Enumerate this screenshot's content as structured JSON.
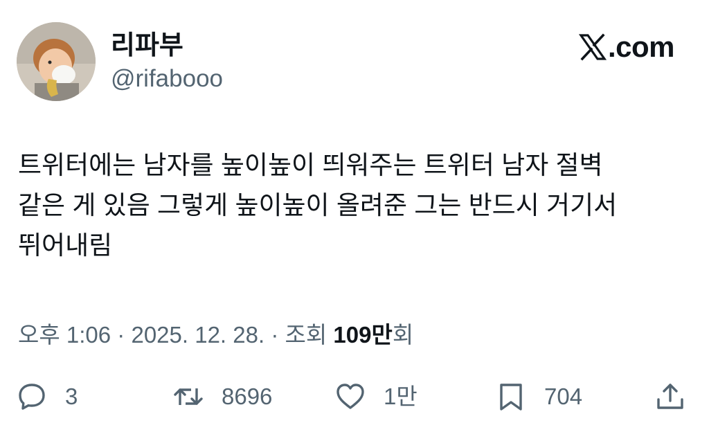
{
  "author": {
    "display_name": "리파부",
    "handle": "@rifabooo",
    "avatar_icon": "profile-photo"
  },
  "brand": {
    "icon": "x-logo-icon",
    "text": ".com"
  },
  "tweet": {
    "lines": [
      "트위터에는 남자를 높이높이 띄워주는 트위터 남자 절벽",
      "같은 게 있음 그렇게 높이높이 올려준 그는 반드시 거기서",
      "뛰어내림"
    ]
  },
  "meta": {
    "time": "오후 1:06",
    "sep1": "·",
    "date": "2025. 12. 28.",
    "sep2": "·",
    "views_label": "조회",
    "views_count": "109만",
    "views_suffix": "회"
  },
  "actions": {
    "reply": {
      "icon": "reply-icon",
      "count": "3"
    },
    "repost": {
      "icon": "repost-icon",
      "count": "8696"
    },
    "like": {
      "icon": "heart-icon",
      "count": "1만"
    },
    "bookmark": {
      "icon": "bookmark-icon",
      "count": "704"
    },
    "share": {
      "icon": "share-icon"
    }
  },
  "colors": {
    "text_primary": "#0f1419",
    "text_secondary": "#536471",
    "background": "#ffffff"
  }
}
